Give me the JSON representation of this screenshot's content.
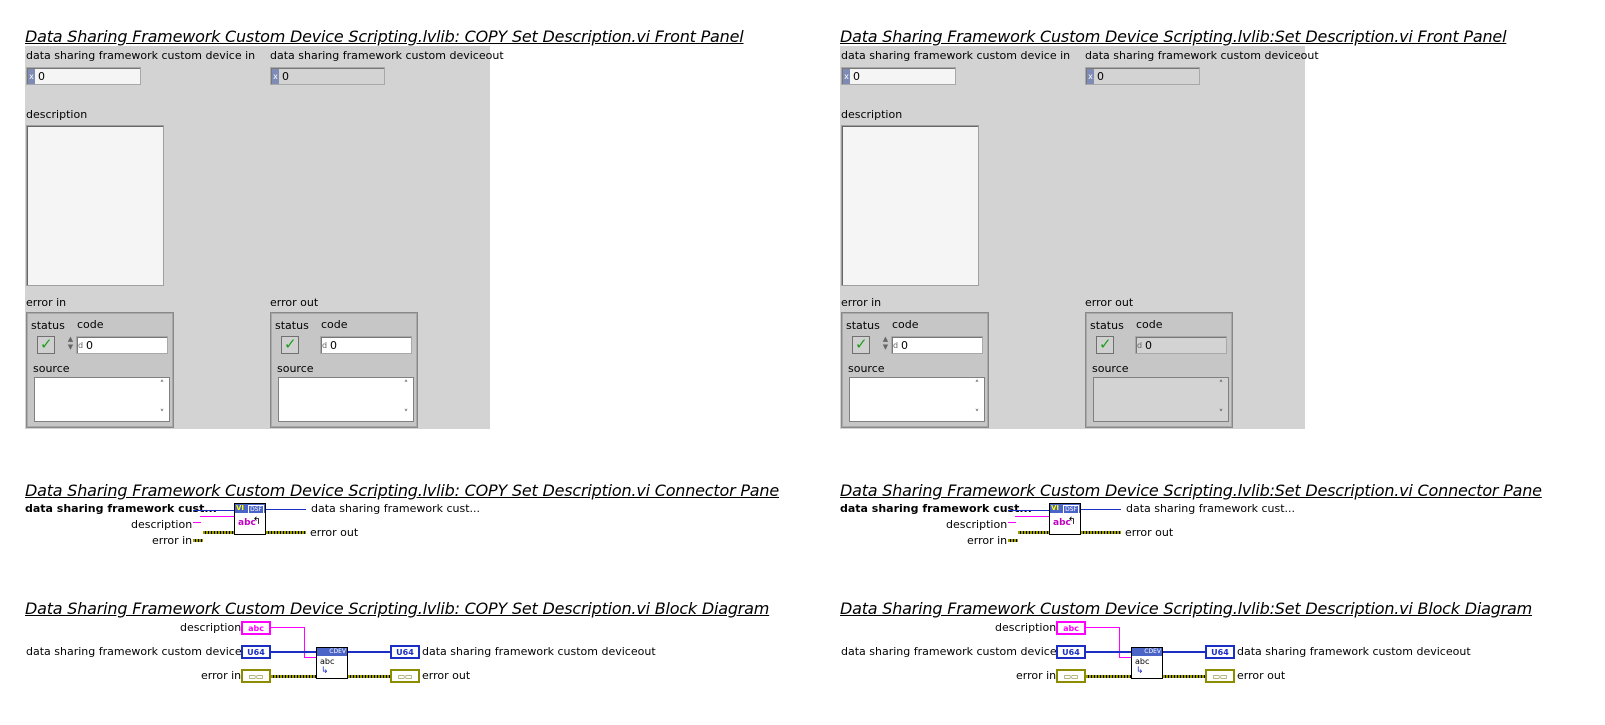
{
  "left": {
    "fp_title": "Data Sharing Framework Custom Device Scripting.lvlib:  COPY  Set Description.vi Front Panel",
    "cp_title": "Data Sharing Framework Custom Device Scripting.lvlib:  COPY  Set Description.vi Connector Pane",
    "bd_title": "Data Sharing Framework Custom Device Scripting.lvlib:  COPY  Set Description.vi Block Diagram"
  },
  "right": {
    "fp_title": "Data Sharing Framework Custom Device Scripting.lvlib:Set Description.vi Front Panel",
    "cp_title": "Data Sharing Framework Custom Device Scripting.lvlib:Set Description.vi Connector Pane",
    "bd_title": "Data Sharing Framework Custom Device Scripting.lvlib:Set Description.vi Block Diagram"
  },
  "front_panel": {
    "device_in_label": "data sharing framework custom device in",
    "device_out_label": "data sharing framework custom deviceout",
    "device_in_value": "0",
    "device_out_value": "0",
    "radix": "x",
    "description_label": "description",
    "error_in_label": "error in",
    "error_out_label": "error out",
    "status_label": "status",
    "code_label": "code",
    "source_label": "source",
    "code_value": "0",
    "code_radix": "d"
  },
  "connector_pane": {
    "in_device": "data sharing framework cust...",
    "in_description": "description",
    "in_error": "error in",
    "out_device": "data sharing framework cust...",
    "out_error": "error out",
    "icon_tag": "DSF",
    "icon_text": "abc"
  },
  "block_diagram": {
    "description": "description",
    "device_in": "data sharing framework custom device in",
    "error_in": "error in",
    "device_out": "data sharing framework custom deviceout",
    "error_out": "error out",
    "u64_term": "U64",
    "str_term": "abc",
    "node_tag": "CDEV",
    "node_text": "abc"
  },
  "colors": {
    "panel_bg": "#d3d3d3",
    "string_wire": "#ff00ff",
    "numeric_wire": "#1c2fc4",
    "error_wire": "#9b9b00",
    "status_ok": "#1a9f1a"
  }
}
